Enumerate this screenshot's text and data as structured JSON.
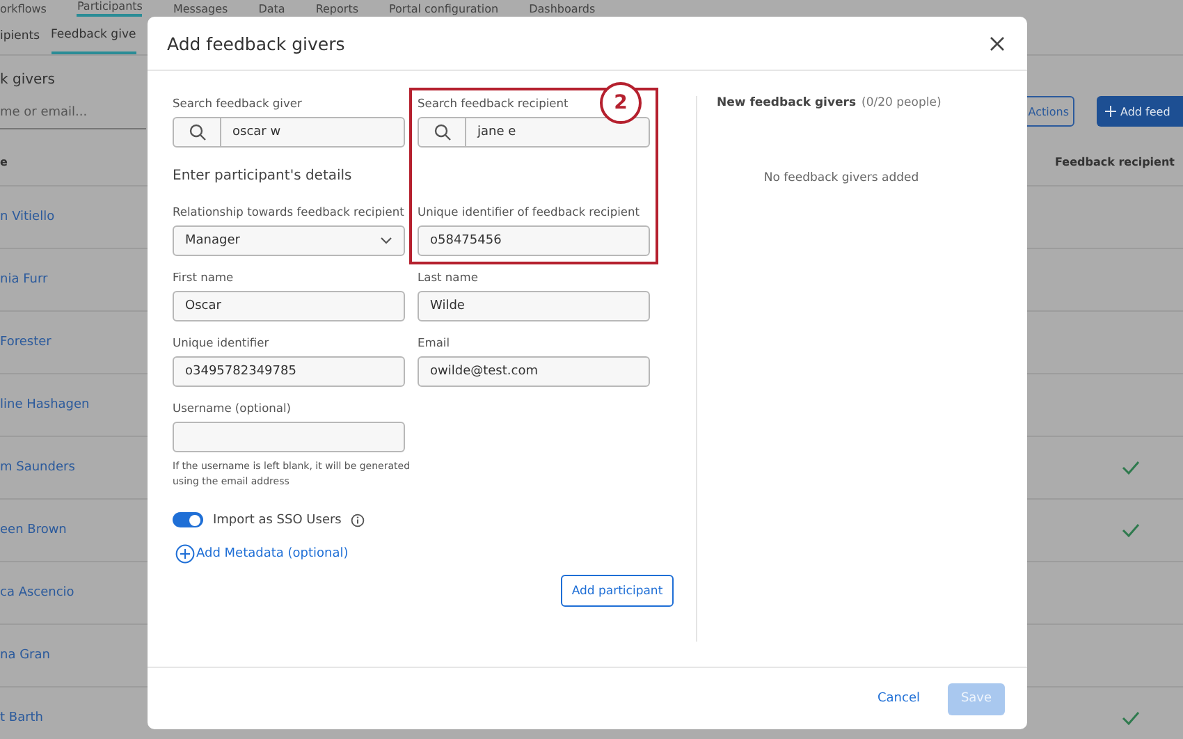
{
  "background": {
    "nav_tabs": [
      {
        "label": "orkflows",
        "selected": false
      },
      {
        "label": "Participants",
        "selected": true
      },
      {
        "label": "Messages",
        "selected": false
      },
      {
        "label": "Data",
        "selected": false
      },
      {
        "label": "Reports",
        "selected": false
      },
      {
        "label": "Portal configuration",
        "selected": false
      },
      {
        "label": "Dashboards",
        "selected": false
      }
    ],
    "sub_tabs": [
      {
        "label": "ipients",
        "selected": false
      },
      {
        "label": "Feedback give",
        "selected": true
      }
    ],
    "section_title": "k givers",
    "search": {
      "placeholder": "me or email..."
    },
    "actions_button": "Actions",
    "add_button": "Add feed",
    "table": {
      "columns": [
        "e",
        "Feedback recipient"
      ],
      "rows": [
        {
          "name": "n Vitiello",
          "feedback_recipient": false
        },
        {
          "name": "nia Furr",
          "feedback_recipient": false
        },
        {
          "name": "Forester",
          "feedback_recipient": false
        },
        {
          "name": "line Hashagen",
          "feedback_recipient": false
        },
        {
          "name": "m Saunders",
          "feedback_recipient": true
        },
        {
          "name": "een Brown",
          "feedback_recipient": true
        },
        {
          "name": "ca Ascencio",
          "feedback_recipient": false
        },
        {
          "name": "na Gran",
          "feedback_recipient": false
        },
        {
          "name": "t Barth",
          "feedback_recipient": true
        }
      ]
    }
  },
  "dialog": {
    "title": "Add feedback givers",
    "giver_search": {
      "label": "Search feedback giver",
      "value": "oscar w"
    },
    "recipient_search": {
      "label": "Search feedback recipient",
      "value": "jane e"
    },
    "section_title": "Enter participant's details",
    "relationship": {
      "label": "Relationship towards feedback recipient",
      "value": "Manager"
    },
    "recipient_id": {
      "label": "Unique identifier of feedback recipient",
      "value": "o58475456"
    },
    "first_name": {
      "label": "First name",
      "value": "Oscar"
    },
    "last_name": {
      "label": "Last name",
      "value": "Wilde"
    },
    "unique_id": {
      "label": "Unique identifier",
      "value": "o3495782349785"
    },
    "email": {
      "label": "Email",
      "value": "owilde@test.com"
    },
    "username": {
      "label": "Username (optional)",
      "hint": "If the username is left blank, it will be generated using the email address"
    },
    "sso_toggle": {
      "label": "Import as SSO Users",
      "on": true
    },
    "metadata_link": "Add Metadata (optional)",
    "add_participant": "Add participant",
    "new_givers": {
      "title": "New feedback givers",
      "count": "(0/20 people)",
      "empty": "No feedback givers added"
    },
    "cancel": "Cancel",
    "save": {
      "label": "Save",
      "disabled": true
    }
  },
  "annotation": {
    "number": "2"
  }
}
